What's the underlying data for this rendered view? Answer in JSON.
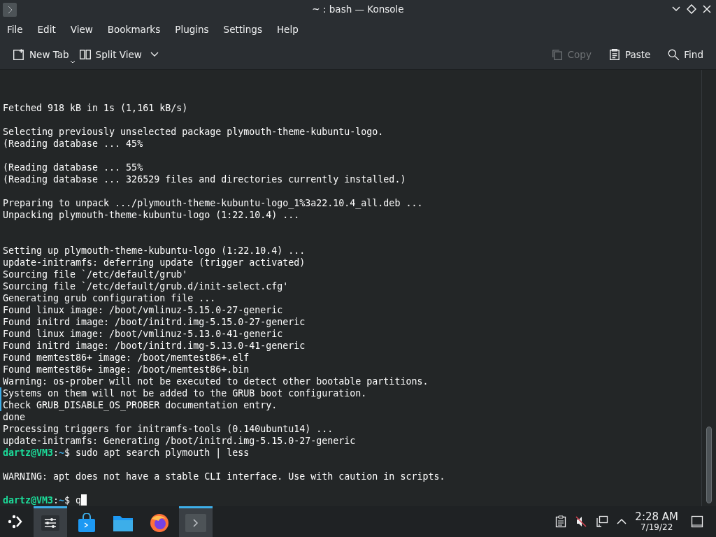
{
  "window": {
    "title": "~ : bash — Konsole"
  },
  "menu": [
    "File",
    "Edit",
    "View",
    "Bookmarks",
    "Plugins",
    "Settings",
    "Help"
  ],
  "toolbar": {
    "left": [
      {
        "label": "New Tab",
        "kind": "newtab",
        "disabled": false
      },
      {
        "label": "Split View",
        "kind": "split",
        "disabled": false
      }
    ],
    "right": [
      {
        "label": "Copy",
        "kind": "copy",
        "disabled": true
      },
      {
        "label": "Paste",
        "kind": "paste",
        "disabled": false
      },
      {
        "label": "Find",
        "kind": "find",
        "disabled": false
      }
    ]
  },
  "terminal": {
    "lines": [
      {
        "kind": "blank"
      },
      {
        "kind": "blank"
      },
      {
        "kind": "text",
        "text": "Fetched 918 kB in 1s (1,161 kB/s)",
        "marked": false
      },
      {
        "kind": "blank"
      },
      {
        "kind": "text",
        "text": "Selecting previously unselected package plymouth-theme-kubuntu-logo.",
        "marked": false
      },
      {
        "kind": "text",
        "text": "(Reading database ... 45%",
        "marked": false
      },
      {
        "kind": "blank"
      },
      {
        "kind": "text",
        "text": "(Reading database ... 55%",
        "marked": false
      },
      {
        "kind": "text",
        "text": "(Reading database ... 326529 files and directories currently installed.)",
        "marked": false
      },
      {
        "kind": "blank"
      },
      {
        "kind": "text",
        "text": "Preparing to unpack .../plymouth-theme-kubuntu-logo_1%3a22.10.4_all.deb ...",
        "marked": false
      },
      {
        "kind": "text",
        "text": "Unpacking plymouth-theme-kubuntu-logo (1:22.10.4) ...",
        "marked": false
      },
      {
        "kind": "blank"
      },
      {
        "kind": "blank"
      },
      {
        "kind": "text",
        "text": "Setting up plymouth-theme-kubuntu-logo (1:22.10.4) ...",
        "marked": false
      },
      {
        "kind": "text",
        "text": "update-initramfs: deferring update (trigger activated)",
        "marked": false
      },
      {
        "kind": "text",
        "text": "Sourcing file `/etc/default/grub'",
        "marked": false
      },
      {
        "kind": "text",
        "text": "Sourcing file `/etc/default/grub.d/init-select.cfg'",
        "marked": false
      },
      {
        "kind": "text",
        "text": "Generating grub configuration file ...",
        "marked": false
      },
      {
        "kind": "text",
        "text": "Found linux image: /boot/vmlinuz-5.15.0-27-generic",
        "marked": false
      },
      {
        "kind": "text",
        "text": "Found initrd image: /boot/initrd.img-5.15.0-27-generic",
        "marked": false
      },
      {
        "kind": "text",
        "text": "Found linux image: /boot/vmlinuz-5.13.0-41-generic",
        "marked": false
      },
      {
        "kind": "text",
        "text": "Found initrd image: /boot/initrd.img-5.13.0-41-generic",
        "marked": false
      },
      {
        "kind": "text",
        "text": "Found memtest86+ image: /boot/memtest86+.elf",
        "marked": false
      },
      {
        "kind": "text",
        "text": "Found memtest86+ image: /boot/memtest86+.bin",
        "marked": false
      },
      {
        "kind": "text",
        "text": "Warning: os-prober will not be executed to detect other bootable partitions.",
        "marked": false
      },
      {
        "kind": "text",
        "text": "Systems on them will not be added to the GRUB boot configuration.",
        "marked": true
      },
      {
        "kind": "text",
        "text": "Check GRUB_DISABLE_OS_PROBER documentation entry.",
        "marked": true
      },
      {
        "kind": "text",
        "text": "done",
        "marked": false
      },
      {
        "kind": "text",
        "text": "Processing triggers for initramfs-tools (0.140ubuntu14) ...",
        "marked": false
      },
      {
        "kind": "text",
        "text": "update-initramfs: Generating /boot/initrd.img-5.15.0-27-generic",
        "marked": false
      },
      {
        "kind": "prompt",
        "user": "dartz@VM3",
        "sep": ":",
        "path": "~",
        "command": "$ sudo apt search plymouth | less",
        "cursor": false
      },
      {
        "kind": "blank"
      },
      {
        "kind": "text",
        "text": "WARNING: apt does not have a stable CLI interface. Use with caution in scripts.",
        "marked": false
      },
      {
        "kind": "blank"
      },
      {
        "kind": "prompt",
        "user": "dartz@VM3",
        "sep": ":",
        "path": "~",
        "command": "$ q",
        "cursor": true
      }
    ]
  },
  "taskbar": {
    "tasks": [
      {
        "kind": "settings",
        "selected": true
      },
      {
        "kind": "store",
        "selected": false
      },
      {
        "kind": "files",
        "selected": false
      },
      {
        "kind": "browser",
        "selected": false
      },
      {
        "kind": "konsole",
        "selected": true
      }
    ],
    "clock": {
      "time": "2:28 AM",
      "date": "7/19/22"
    }
  }
}
